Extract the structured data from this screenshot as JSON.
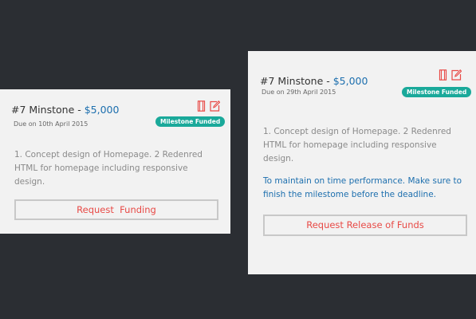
{
  "cards": [
    {
      "title_prefix": "#7 Minstone - ",
      "amount": "$5,000",
      "due": "Due on 10th April 2015",
      "badge": "Milestone Funded",
      "description": "1. Concept design of Homepage. 2 Redenred HTML  for homepage including responsive design.",
      "button_label": "Request  Funding"
    },
    {
      "title_prefix": "#7 Minstone - ",
      "amount": "$5,000",
      "due": "Due on 29th April 2015",
      "badge": "Milestone Funded",
      "description": "1. Concept design of Homepage. 2 Redenred HTML  for homepage including responsive design.",
      "note": "To maintain on time performance. Make sure to finish the milestome before the deadline.",
      "button_label": "Request Release of Funds"
    }
  ],
  "icons": [
    "document-icon",
    "edit-icon"
  ],
  "colors": {
    "background": "#2b2e33",
    "card": "#f2f2f2",
    "amount": "#1d6fae",
    "badge": "#1aa99a",
    "icon": "#e84a46",
    "button_text": "#e84a46"
  }
}
